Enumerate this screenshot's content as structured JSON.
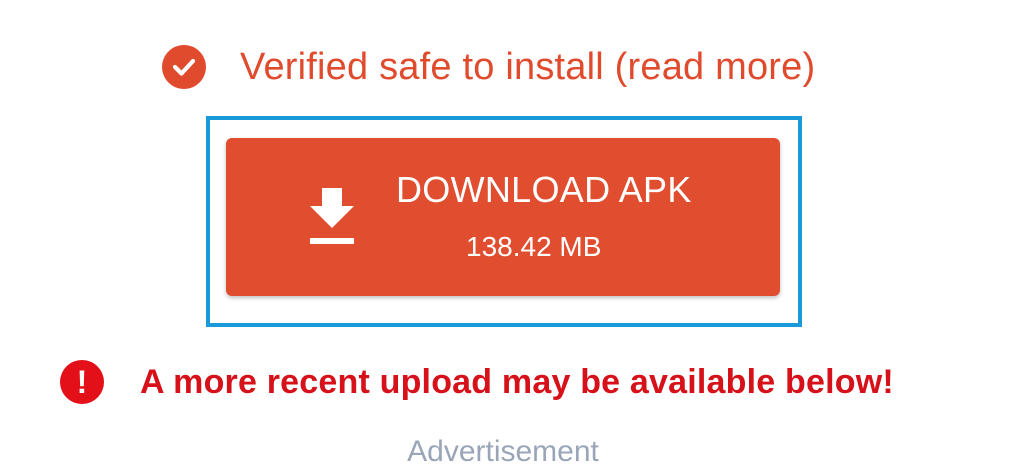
{
  "verified": {
    "text": "Verified safe to install (read more)",
    "icon": "check-circle-icon",
    "color": "#e04b2e"
  },
  "download": {
    "label": "DOWNLOAD APK",
    "size": "138.42 MB",
    "icon": "download-icon",
    "background": "#e14d2f",
    "focus_color": "#1a9ad9"
  },
  "warning": {
    "text": "A more recent upload may be available below!",
    "icon": "exclamation-circle-icon",
    "color": "#d6111a"
  },
  "ad": {
    "label": "Advertisement"
  }
}
